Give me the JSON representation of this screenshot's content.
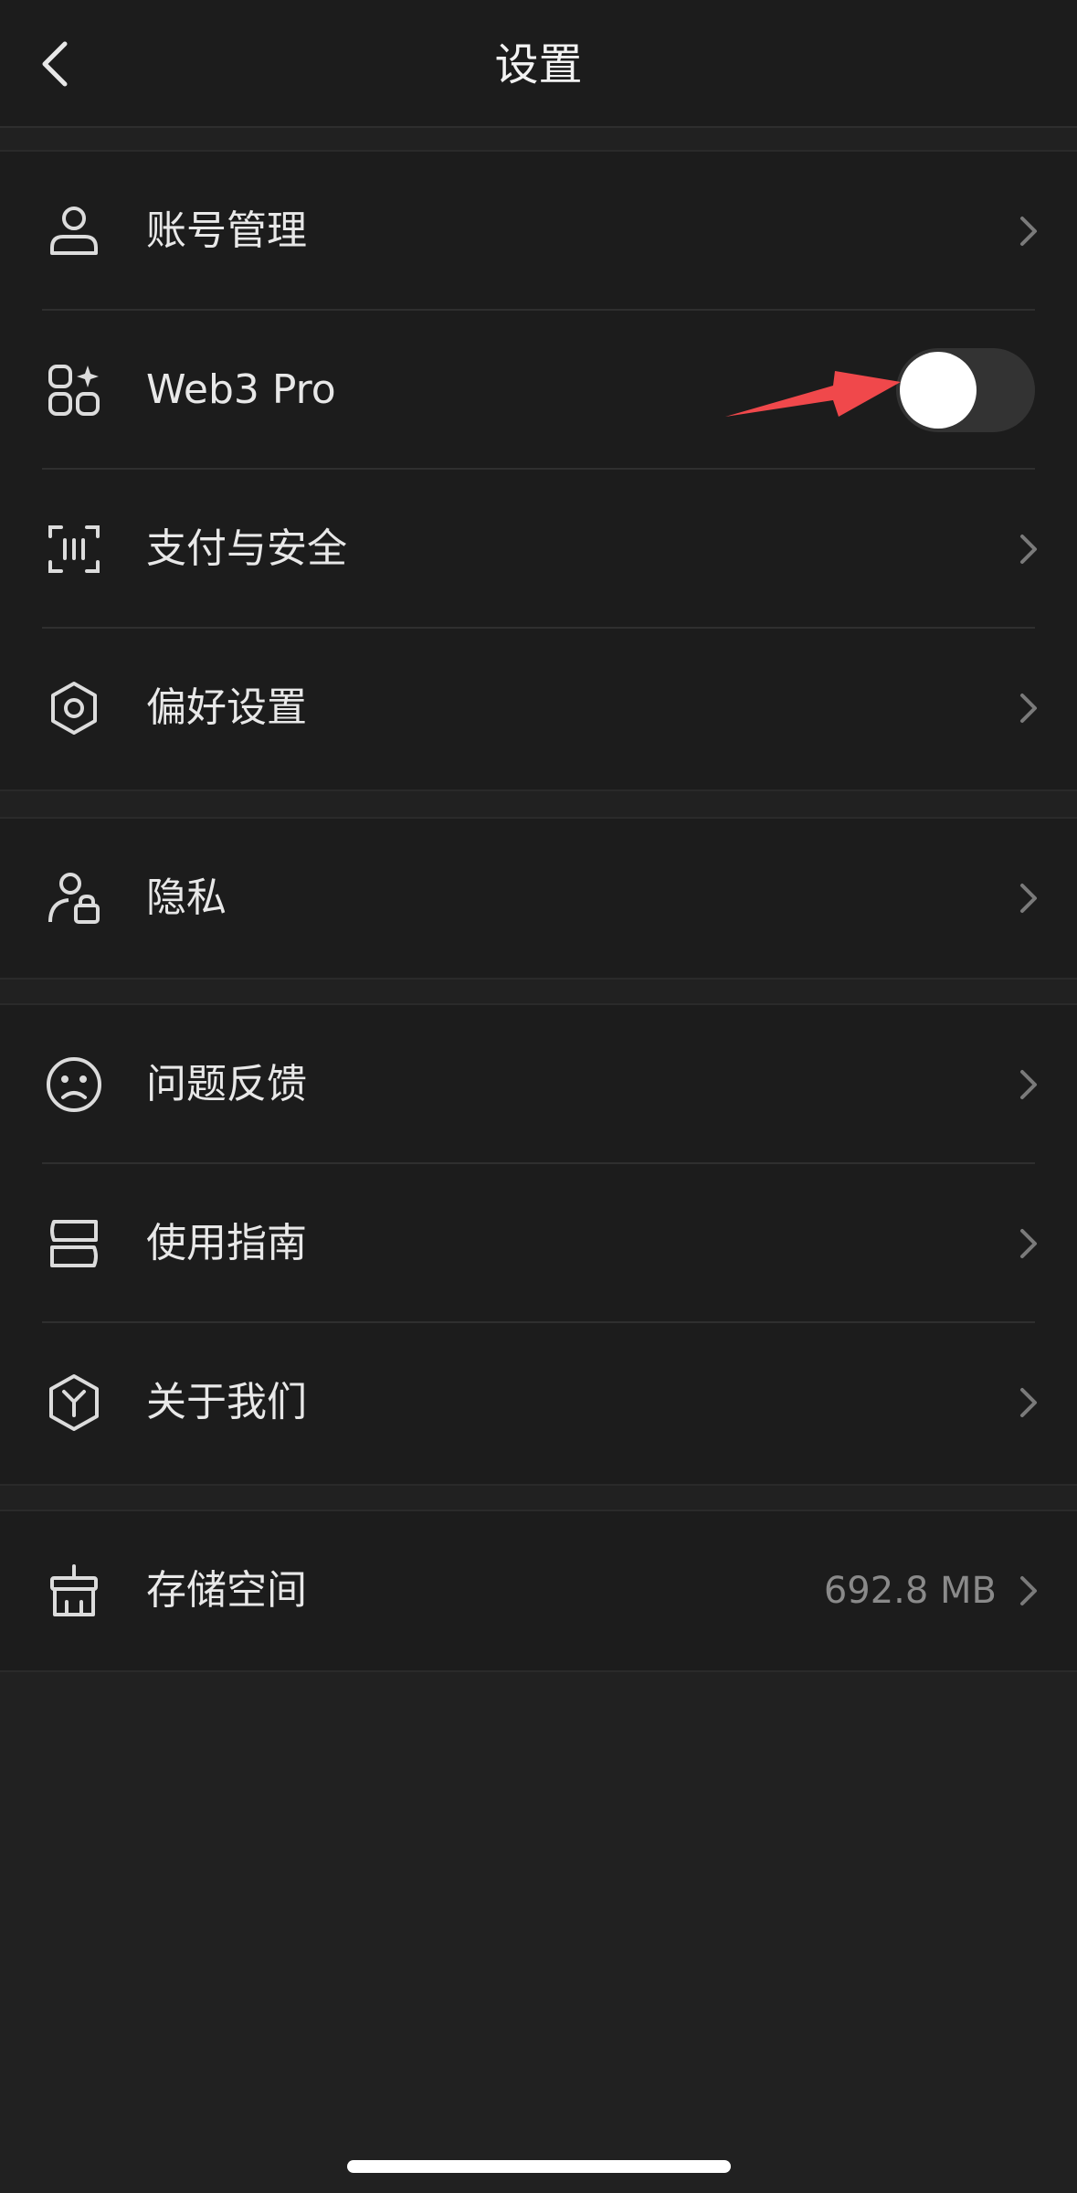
{
  "header": {
    "title": "设置",
    "back_icon": "chevron-left-icon"
  },
  "groups": [
    {
      "items": [
        {
          "label": "账号管理",
          "icon": "user-icon",
          "accessory": "chevron"
        },
        {
          "label": "Web3 Pro",
          "icon": "apps-sparkle-icon",
          "accessory": "toggle",
          "toggle_on": false
        },
        {
          "label": "支付与安全",
          "icon": "scan-icon",
          "accessory": "chevron"
        },
        {
          "label": "偏好设置",
          "icon": "gear-icon",
          "accessory": "chevron"
        }
      ]
    },
    {
      "items": [
        {
          "label": "隐私",
          "icon": "user-lock-icon",
          "accessory": "chevron"
        }
      ]
    },
    {
      "items": [
        {
          "label": "问题反馈",
          "icon": "sad-face-icon",
          "accessory": "chevron"
        },
        {
          "label": "使用指南",
          "icon": "book-icon",
          "accessory": "chevron"
        },
        {
          "label": "关于我们",
          "icon": "cube-icon",
          "accessory": "chevron"
        }
      ]
    },
    {
      "items": [
        {
          "label": "存储空间",
          "icon": "broom-icon",
          "accessory": "chevron",
          "value": "692.8 MB"
        }
      ]
    }
  ],
  "colors": {
    "background": "#212121",
    "card": "#1c1c1c",
    "text": "#e8e8e8",
    "secondary_text": "#8a8a8a",
    "toggle_track": "#333333",
    "annotation": "#f0484b"
  }
}
